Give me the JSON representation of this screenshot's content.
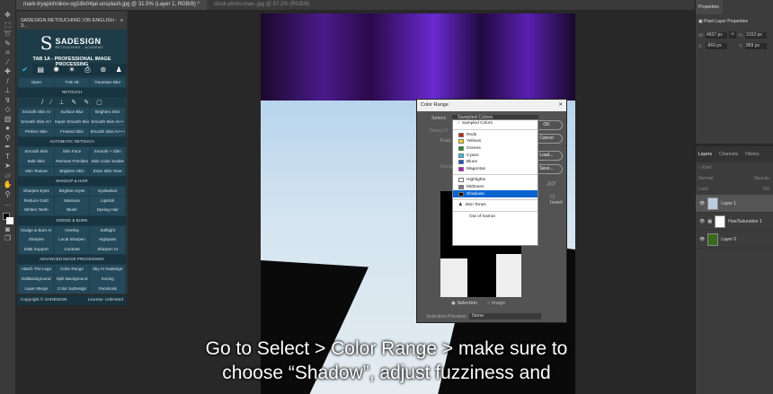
{
  "doc_tabs": [
    {
      "label": "mark-tryapichnikov-og1l8v04jal-unsplash.jpg @ 31.5% (Layer 1, RGB/8) *"
    },
    {
      "label": "stock-photo-man-.jpg @ 57.2% (RGB/8)"
    }
  ],
  "plugin": {
    "title": "SADESIGN RETOUCHING V35 ENGLISH - 3...",
    "logo_main": "SADESIGN",
    "logo_sub": "RETOUCHING - ACADEMY",
    "tab_title": "TAB 1A - PROFESSIONAL IMAGE PROCESSING",
    "top_buttons": [
      "Open",
      "TAB 1B",
      "Gaussian Blur"
    ],
    "sections": [
      {
        "label": "RETOUCH",
        "rows": [
          [
            "Smooth Skin AI",
            "Surface Blur",
            "Brighten Skin"
          ],
          [
            "Smooth Skin AI+",
            "Super Smooth Skin",
            "Smooth Skin AI++"
          ],
          [
            "Perfect Skin",
            "Frosted Skin",
            "Smooth Skin AI+++"
          ]
        ]
      },
      {
        "label": "AUTOMATIC RETOUCH",
        "rows": [
          [
            "Smooth Skin",
            "Slim Face",
            "Smooth + Slim"
          ],
          [
            "Bulk Skin",
            "Remove Freckles",
            "Skin Color Scales"
          ],
          [
            "Skin Texture",
            "Brighten Skin",
            "Even Skin Tone"
          ]
        ]
      },
      {
        "label": "MAKEUP & HAIR",
        "rows": [
          [
            "Sharpen Eyes",
            "Brighten Eyes",
            "Eyelashes"
          ],
          [
            "Reduce Gold",
            "Mascara",
            "Lipstick"
          ],
          [
            "Whiten Teeth",
            "Blush",
            "Dyeing Hair"
          ]
        ]
      },
      {
        "label": "DODGE & BURN",
        "rows": [
          [
            "Dodge & Burn AI",
            "Overlay",
            "Softlight"
          ],
          [
            "Sharpen",
            "Local Sharpen",
            "Highpass"
          ],
          [
            "D&B Support",
            "Contrast",
            "Sharpen AI"
          ]
        ]
      },
      {
        "label": "ADVANCED IMAGE PROCESSING",
        "rows": [
          [
            "Attach The Logo",
            "Color Range",
            "Sky AI Sadesign"
          ],
          [
            "EditBackground",
            "Split Background",
            "Ironing"
          ],
          [
            "Layer Merge",
            "Color SaDesign",
            "Facebook"
          ]
        ]
      }
    ],
    "copyright": "Copyright © SADESIGN",
    "license": "License: Unlimited"
  },
  "dialog": {
    "title": "Color Range",
    "select_label": "Select:",
    "select_value": "Sampled Colors",
    "detect_faces": "Detect F",
    "fuzziness": "Fuzz",
    "range": "Rang",
    "ok": "OK",
    "cancel": "Cancel",
    "load": "Load...",
    "save": "Save...",
    "invert": "Invert",
    "selection": "Selection",
    "image": "Image",
    "preview_label": "Selection Preview:",
    "preview_value": "None",
    "options": [
      {
        "label": "Sampled Colors",
        "color": null
      },
      {
        "label": "Reds",
        "color": "#d02010"
      },
      {
        "label": "Yellows",
        "color": "#f0e000"
      },
      {
        "label": "Greens",
        "color": "#209020"
      },
      {
        "label": "Cyans",
        "color": "#30c0f0"
      },
      {
        "label": "Blues",
        "color": "#1050e0"
      },
      {
        "label": "Magentas",
        "color": "#c010c0"
      },
      {
        "label": "Highlights",
        "color": "#ffffff"
      },
      {
        "label": "Midtones",
        "color": "#808080"
      },
      {
        "label": "Shadows",
        "color": "#000000"
      },
      {
        "label": "Skin Tones",
        "color": null
      },
      {
        "label": "Out of Gamut",
        "color": null
      }
    ],
    "selected_option": "Shadows"
  },
  "properties": {
    "tab": "Properties",
    "heading": "Pixel Layer Properties",
    "w_label": "W:",
    "w": "4937 px",
    "h_label": "H:",
    "h": "3152 px",
    "x_label": "X:",
    "x": "-869 px",
    "y_label": "Y:",
    "y": "869 px"
  },
  "layers": {
    "tabs": [
      "Layers",
      "Channels",
      "History"
    ],
    "kind": "Kind",
    "mode": "Normal",
    "opacity": "Opacity:",
    "lock": "Lock:",
    "fill": "Fill:",
    "items": [
      {
        "name": "Layer 1"
      },
      {
        "name": "Hue/Saturation 1"
      },
      {
        "name": "Layer 0"
      }
    ]
  },
  "subtitle": {
    "line1": "Go to Select > Color Range > make sure to",
    "line2": "choose “Shadow”, adjust fuzziness and"
  }
}
